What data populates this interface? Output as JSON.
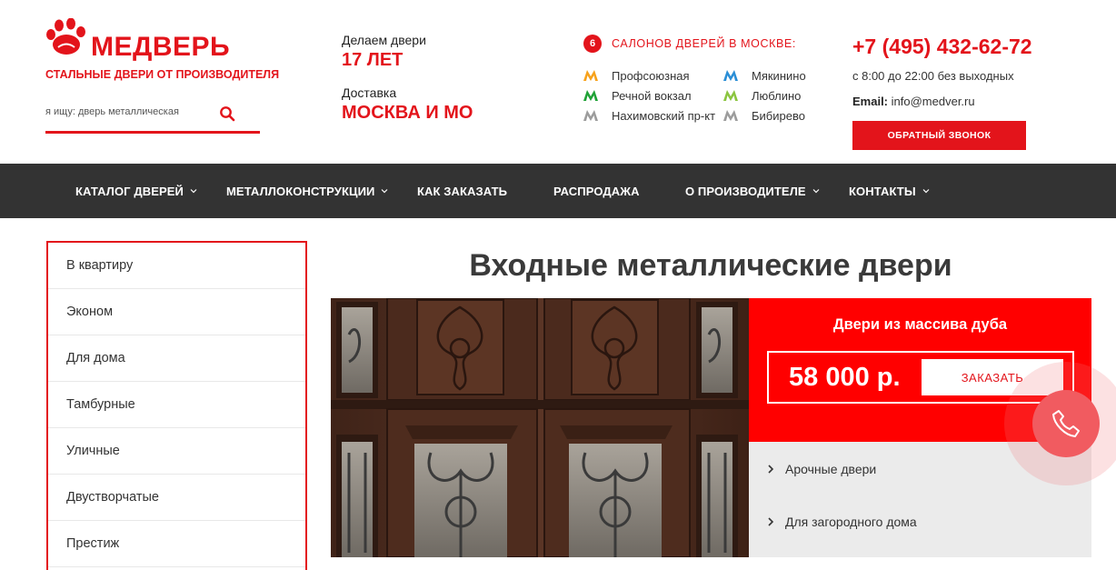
{
  "header": {
    "brand": "МЕДВЕРЬ",
    "tagline": "СТАЛЬНЫЕ ДВЕРИ ОТ ПРОИЗВОДИТЕЛЯ",
    "search_placeholder": "я ищу: дверь металлическая",
    "made_label": "Делаем двери",
    "made_value": "17 ЛЕТ",
    "delivery_label": "Доставка",
    "delivery_value": "МОСКВА И МО",
    "salons_count": "6",
    "salons_title": "САЛОНОВ ДВЕРЕЙ В МОСКВЕ:",
    "metro": [
      {
        "name": "Профсоюзная",
        "color": "#f7a21b"
      },
      {
        "name": "Речной вокзал",
        "color": "#1fa236"
      },
      {
        "name": "Нахимовский пр-кт",
        "color": "#9c9c9c"
      },
      {
        "name": "Мякинино",
        "color": "#2a8ed6"
      },
      {
        "name": "Люблино",
        "color": "#8bc53f"
      },
      {
        "name": "Бибирево",
        "color": "#9c9c9c"
      }
    ],
    "phone": "+7 (495) 432-62-72",
    "hours": "с 8:00 до 22:00 без выходных",
    "email_label": "Email:",
    "email": "info@medver.ru",
    "callback_label": "ОБРАТНЫЙ ЗВОНОК"
  },
  "nav": {
    "items": [
      {
        "label": "КАТАЛОГ ДВЕРЕЙ",
        "has_dropdown": true
      },
      {
        "label": "МЕТАЛЛОКОНСТРУКЦИИ",
        "has_dropdown": true
      },
      {
        "label": "КАК ЗАКАЗАТЬ",
        "has_dropdown": false
      },
      {
        "label": "РАСПРОДАЖА",
        "has_dropdown": false
      },
      {
        "label": "О ПРОИЗВОДИТЕЛЕ",
        "has_dropdown": true
      },
      {
        "label": "КОНТАКТЫ",
        "has_dropdown": true
      }
    ]
  },
  "sidebar": {
    "items": [
      {
        "label": "В квартиру"
      },
      {
        "label": "Эконом"
      },
      {
        "label": "Для дома"
      },
      {
        "label": "Тамбурные"
      },
      {
        "label": "Уличные"
      },
      {
        "label": "Двустворчатые"
      },
      {
        "label": "Престиж"
      }
    ]
  },
  "main": {
    "title": "Входные металлические двери",
    "promo_title": "Двери из массива дуба",
    "price": "58 000 р.",
    "order_label": "ЗАКАЗАТЬ",
    "submenu": [
      {
        "label": "Арочные двери"
      },
      {
        "label": "Для загородного дома"
      }
    ]
  },
  "colors": {
    "accent": "#e3141b",
    "nav_bg": "#333333",
    "promo_bg": "#ff0000",
    "call_widget": "#f15b60"
  },
  "icons": {
    "logo": "bear-paw-icon",
    "search": "search-icon",
    "metro": "metro-m-icon",
    "dropdown": "chevron-down-icon",
    "submenu_arrow": "chevron-right-icon",
    "call": "phone-icon"
  }
}
